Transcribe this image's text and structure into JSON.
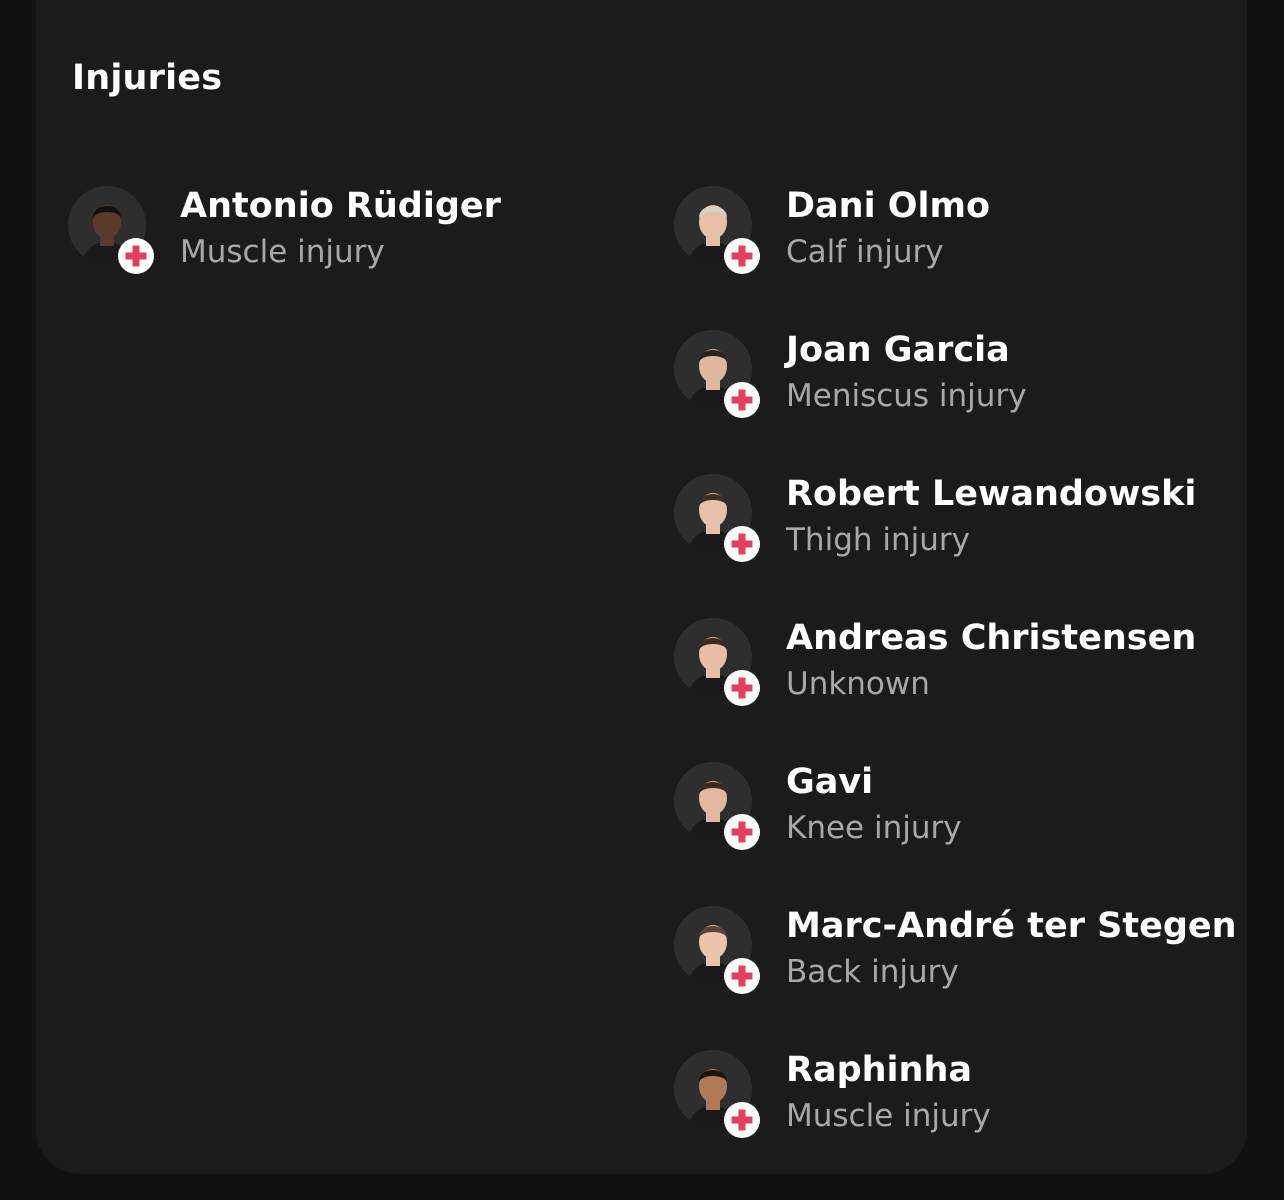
{
  "section": {
    "title": "Injuries"
  },
  "colors": {
    "card_background": "#1b1b1b",
    "badge_cross": "#e0405e",
    "name_text": "#ffffff",
    "injury_text": "#a8a8a8"
  },
  "home_team": {
    "players": [
      {
        "name": "Antonio Rüdiger",
        "injury": "Muscle injury",
        "skin": "#5a3a2a",
        "hair": "#111111"
      }
    ]
  },
  "away_team": {
    "players": [
      {
        "name": "Dani Olmo",
        "injury": "Calf injury",
        "skin": "#e8c0a8",
        "hair": "#d8d0c0"
      },
      {
        "name": "Joan Garcia",
        "injury": "Meniscus injury",
        "skin": "#e0b8a0",
        "hair": "#2a2420"
      },
      {
        "name": "Robert Lewandowski",
        "injury": "Thigh injury",
        "skin": "#e6c2aa",
        "hair": "#3a3028"
      },
      {
        "name": "Andreas Christensen",
        "injury": "Unknown",
        "skin": "#e8bea6",
        "hair": "#3a2c22"
      },
      {
        "name": "Gavi",
        "injury": "Knee injury",
        "skin": "#e4b89e",
        "hair": "#3a2a20"
      },
      {
        "name": "Marc-André ter Stegen",
        "injury": "Back injury",
        "skin": "#ecc4ac",
        "hair": "#5a4434"
      },
      {
        "name": "Raphinha",
        "injury": "Muscle injury",
        "skin": "#b07a5a",
        "hair": "#1a1410"
      }
    ]
  }
}
